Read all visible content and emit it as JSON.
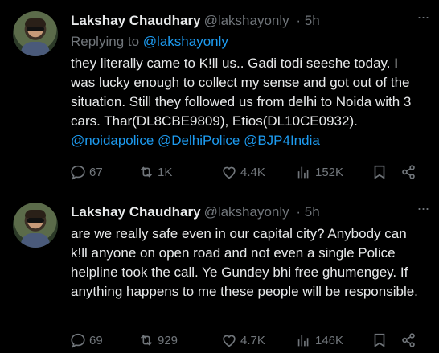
{
  "tweets": [
    {
      "author_name": "Lakshay Chaudhary",
      "author_handle": "@lakshayonly",
      "time": "· 5h",
      "replying_prefix": "Replying to",
      "replying_to": "@lakshayonly",
      "text_plain": "they literally came to K!ll us.. Gadi todi seeshe today. I was lucky enough to collect my sense and got out of the situation. Still they followed us from delhi to Noida with 3 cars. Thar(DL8CBE9809), Etios(DL10CE0932).",
      "mentions": [
        "@noidapolice",
        "@DelhiPolice",
        "@BJP4India"
      ],
      "replies": "67",
      "retweets": "1K",
      "likes": "4.4K",
      "views": "152K"
    },
    {
      "author_name": "Lakshay Chaudhary",
      "author_handle": "@lakshayonly",
      "time": "· 5h",
      "text_plain": "are we really safe even in our capital city? Anybody can k!ll anyone on open road and not even a single Police helpline took the call. Ye Gundey bhi free ghumengey. If anything happens to me these people will be responsible.",
      "replies": "69",
      "retweets": "929",
      "likes": "4.7K",
      "views": "146K"
    }
  ],
  "icons": {
    "reply": "reply-icon",
    "retweet": "retweet-icon",
    "like": "heart-icon",
    "views": "views-icon",
    "bookmark": "bookmark-icon",
    "share": "share-icon",
    "more": "more-icon"
  },
  "colors": {
    "background": "#000000",
    "text": "#e7e9ea",
    "secondary": "#71767b",
    "link": "#1d9bf0",
    "divider": "#2f3336"
  }
}
